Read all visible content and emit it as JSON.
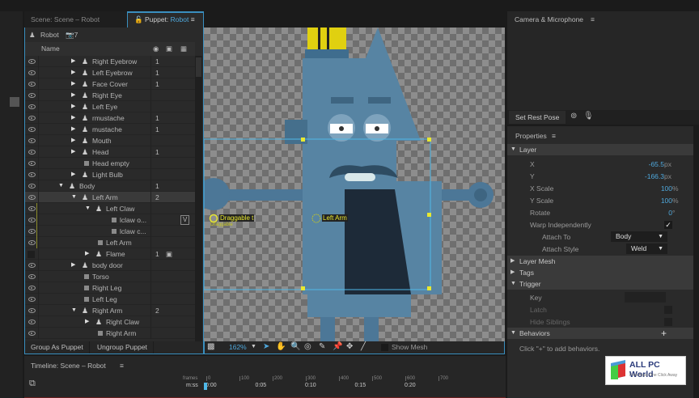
{
  "tabs": {
    "scene": "Scene: Scene – Robot",
    "puppet_prefix": "Puppet:",
    "puppet_name": "Robot"
  },
  "puppet_panel": {
    "name": "Robot",
    "camera_count": "7",
    "col_name": "Name",
    "rows": [
      {
        "name": "Right Eyebrow",
        "level": 2,
        "kind": "puppet",
        "exp": "right",
        "count": "1"
      },
      {
        "name": "Left Eyebrow",
        "level": 2,
        "kind": "puppet",
        "exp": "right",
        "count": "1"
      },
      {
        "name": "Face Cover",
        "level": 2,
        "kind": "puppet",
        "exp": "right",
        "count": "1"
      },
      {
        "name": "Right Eye",
        "level": 2,
        "kind": "puppet",
        "exp": "right",
        "count": ""
      },
      {
        "name": "Left Eye",
        "level": 2,
        "kind": "puppet",
        "exp": "right",
        "count": ""
      },
      {
        "name": "rmustache",
        "level": 2,
        "kind": "puppet",
        "exp": "right",
        "count": "1"
      },
      {
        "name": "mustache",
        "level": 2,
        "kind": "puppet",
        "exp": "right",
        "count": "1"
      },
      {
        "name": "Mouth",
        "level": 2,
        "kind": "puppet",
        "exp": "right",
        "count": ""
      },
      {
        "name": "Head",
        "level": 2,
        "kind": "puppet",
        "exp": "right",
        "count": "1"
      },
      {
        "name": "Head empty",
        "level": 2,
        "kind": "layer",
        "exp": "",
        "count": ""
      },
      {
        "name": "Light Bulb",
        "level": 2,
        "kind": "puppet",
        "exp": "right",
        "count": ""
      },
      {
        "name": "Body",
        "level": 1,
        "kind": "puppet",
        "exp": "down",
        "count": "1"
      },
      {
        "name": "Left Arm",
        "level": 2,
        "kind": "puppet",
        "exp": "down",
        "count": "2",
        "selected": true
      },
      {
        "name": "Left Claw",
        "level": 3,
        "kind": "puppet",
        "exp": "down",
        "count": "",
        "bar": true
      },
      {
        "name": "lclaw o...",
        "level": 4,
        "kind": "layer",
        "exp": "",
        "count": "",
        "extra": "V",
        "bar": true
      },
      {
        "name": "lclaw c...",
        "level": 4,
        "kind": "layer",
        "exp": "",
        "count": "",
        "bar": true
      },
      {
        "name": "Left Arm",
        "level": 3,
        "kind": "layer",
        "exp": "",
        "count": "",
        "bar": true
      },
      {
        "name": "Flame",
        "level": 3,
        "kind": "puppet",
        "exp": "right",
        "count": "1",
        "hidden": true,
        "camera": true
      },
      {
        "name": "body door",
        "level": 2,
        "kind": "puppet",
        "exp": "right",
        "count": ""
      },
      {
        "name": "Torso",
        "level": 2,
        "kind": "layer",
        "exp": "",
        "count": ""
      },
      {
        "name": "Right Leg",
        "level": 2,
        "kind": "layer",
        "exp": "",
        "count": ""
      },
      {
        "name": "Left Leg",
        "level": 2,
        "kind": "layer",
        "exp": "",
        "count": ""
      },
      {
        "name": "Right Arm",
        "level": 2,
        "kind": "puppet",
        "exp": "down",
        "count": "2"
      },
      {
        "name": "Right Claw",
        "level": 3,
        "kind": "puppet",
        "exp": "right",
        "count": ""
      },
      {
        "name": "Right Arm",
        "level": 3,
        "kind": "layer",
        "exp": "",
        "count": ""
      }
    ],
    "group_button": "Group As Puppet",
    "ungroup_button": "Ungroup Puppet"
  },
  "canvas": {
    "handle_labels": {
      "draggable": "Draggable t",
      "draggable_sub": "Draggable",
      "left_arm": "Left Arm"
    },
    "zoom": "162%",
    "show_mesh": "Show Mesh",
    "accent": "#3a8fbf",
    "handle_color": "#e8e830"
  },
  "timeline": {
    "title": "Timeline: Scene – Robot",
    "frames_label": "frames",
    "mss_label": "m:ss",
    "frame_ticks": [
      "0",
      "100",
      "200",
      "300",
      "400",
      "500",
      "600",
      "700"
    ],
    "time_ticks": [
      "0:00",
      "0:05",
      "0:10",
      "0:15",
      "0:20"
    ]
  },
  "camera": {
    "title": "Camera & Microphone",
    "rest_pose": "Set Rest Pose"
  },
  "properties": {
    "title": "Properties",
    "layer": "Layer",
    "x_label": "X",
    "x_value": "-65.5",
    "x_unit": "px",
    "y_label": "Y",
    "y_value": "-166.3",
    "y_unit": "px",
    "xscale_label": "X Scale",
    "xscale_value": "100",
    "xscale_unit": "%",
    "yscale_label": "Y Scale",
    "yscale_value": "100",
    "yscale_unit": "%",
    "rotate_label": "Rotate",
    "rotate_value": "0",
    "rotate_unit": "°",
    "warp_label": "Warp Independently",
    "warp_checked": true,
    "attach_to_label": "Attach To",
    "attach_to_value": "Body",
    "attach_style_label": "Attach Style",
    "attach_style_value": "Weld",
    "layer_mesh": "Layer Mesh",
    "tags": "Tags",
    "trigger": "Trigger",
    "key_label": "Key",
    "latch_label": "Latch",
    "hide_siblings_label": "Hide Siblings",
    "behaviors": "Behaviors",
    "behaviors_hint": "Click \"+\" to add behaviors."
  },
  "watermark": {
    "title": "ALL PC World",
    "subtitle": "Free Apps One Click Away"
  }
}
